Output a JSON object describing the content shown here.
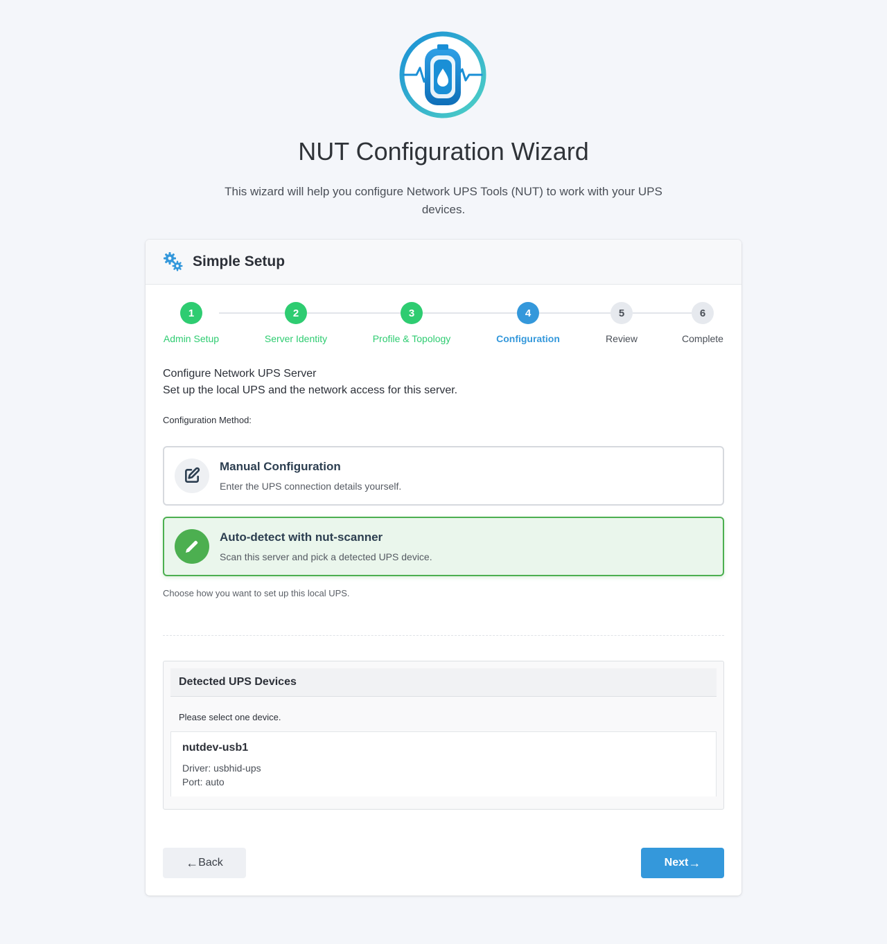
{
  "header": {
    "title": "NUT Configuration Wizard",
    "subtitle": "This wizard will help you configure Network UPS Tools (NUT) to work with your UPS devices."
  },
  "card": {
    "title": "Simple Setup"
  },
  "steps": [
    {
      "number": "1",
      "label": "Admin Setup",
      "state": "done"
    },
    {
      "number": "2",
      "label": "Server Identity",
      "state": "done"
    },
    {
      "number": "3",
      "label": "Profile & Topology",
      "state": "done"
    },
    {
      "number": "4",
      "label": "Configuration",
      "state": "active"
    },
    {
      "number": "5",
      "label": "Review",
      "state": "pending"
    },
    {
      "number": "6",
      "label": "Complete",
      "state": "pending"
    }
  ],
  "section": {
    "title": "Configure Network UPS Server",
    "description": "Set up the local UPS and the network access for this server.",
    "method_label": "Configuration Method:",
    "help": "Choose how you want to set up this local UPS."
  },
  "options": {
    "manual": {
      "title": "Manual Configuration",
      "description": "Enter the UPS connection details yourself.",
      "icon": "edit-icon"
    },
    "auto": {
      "title": "Auto-detect with nut-scanner",
      "description": "Scan this server and pick a detected UPS device.",
      "icon": "pencil-icon",
      "selected": true
    }
  },
  "devices": {
    "title": "Detected UPS Devices",
    "hint": "Please select one device.",
    "items": [
      {
        "name": "nutdev-usb1",
        "driver": "Driver: usbhid-ups",
        "port": "Port: auto"
      }
    ]
  },
  "buttons": {
    "back": "Back",
    "next": "Next"
  },
  "colors": {
    "done": "#2ecc71",
    "active": "#3498db",
    "selected": "#4caf50",
    "primary": "#3498db"
  }
}
